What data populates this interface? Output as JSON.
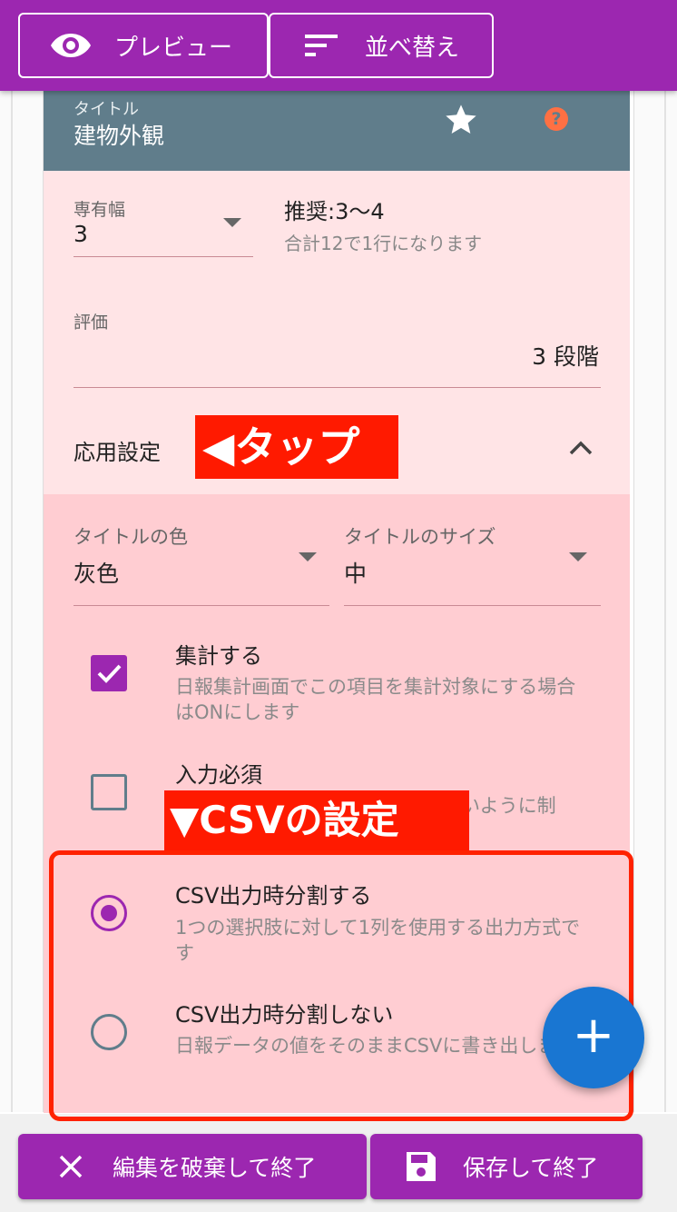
{
  "toolbar": {
    "preview_label": "プレビュー",
    "sort_label": "並べ替え"
  },
  "card": {
    "title_label": "タイトル",
    "title_value": "建物外観",
    "help_glyph": "?"
  },
  "width_field": {
    "label": "専有幅",
    "value": "3",
    "hint_main": "推奨:3〜4",
    "hint_sub": "合計12で1行になります"
  },
  "rating_field": {
    "label": "評価",
    "value": "3 段階"
  },
  "advanced": {
    "title": "応用設定",
    "tap_annotation": "◀タップ",
    "title_color": {
      "label": "タイトルの色",
      "value": "灰色"
    },
    "title_size": {
      "label": "タイトルのサイズ",
      "value": "中"
    },
    "aggregate": {
      "label": "集計する",
      "desc": "日報集計画面でこの項目を集計対象にする場合はONにします",
      "checked": true
    },
    "required": {
      "label": "入力必須",
      "desc_visible": "いように制",
      "checked": false
    },
    "csv_annotation": "▼CSVの設定",
    "csv_split": {
      "label": "CSV出力時分割する",
      "desc": "1つの選択肢に対して1列を使用する出力方式です",
      "selected": true
    },
    "csv_nosplit": {
      "label": "CSV出力時分割しない",
      "desc": "日報データの値をそのままCSVに書き出します",
      "selected": false
    }
  },
  "fab": {
    "label": "+"
  },
  "footer": {
    "discard_label": "編集を破棄して終了",
    "save_label": "保存して終了"
  },
  "colors": {
    "primary": "#9c27b0",
    "card_header": "#607d8b",
    "fab": "#1976d2",
    "annotation": "#ff1a00"
  }
}
